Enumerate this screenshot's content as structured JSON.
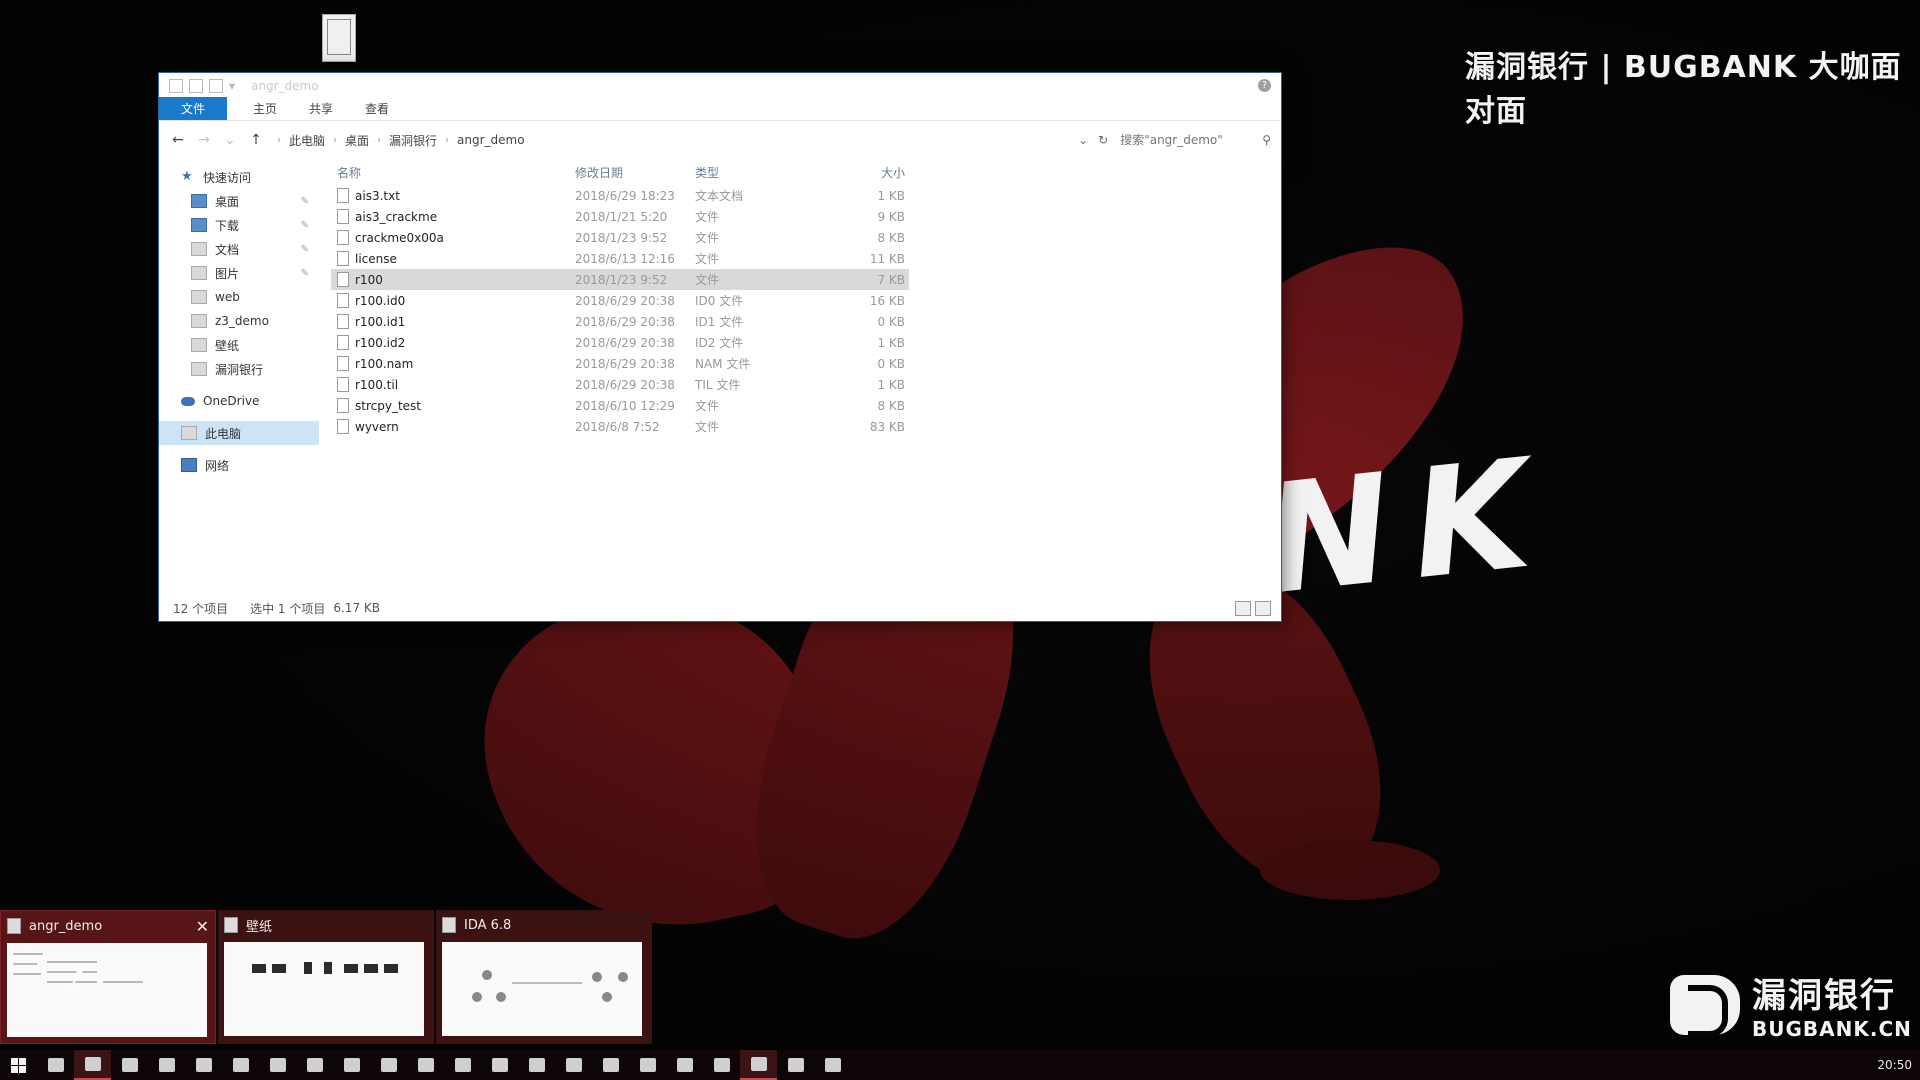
{
  "brand": {
    "top_text": "漏洞银行 | BUGBANK 大咖面对面",
    "bottom_cn": "漏洞银行",
    "bottom_en": "BUGBANK.CN",
    "wallpaper_letters": "NK"
  },
  "colors": {
    "accent": "#1979ca",
    "wallpaper_red": "#7a1719",
    "taskbar": "#0e0506"
  },
  "explorer": {
    "title": "angr_demo",
    "help_icon": "?",
    "ribbon_tabs": [
      "文件",
      "主页",
      "共享",
      "查看"
    ],
    "breadcrumb": [
      "此电脑",
      "桌面",
      "漏洞银行",
      "angr_demo"
    ],
    "search_placeholder": "搜索\"angr_demo\"",
    "nav": [
      {
        "label": "快速访问",
        "icon": "star-icon"
      },
      {
        "label": "桌面",
        "icon": "desktop-icon",
        "pinned": true
      },
      {
        "label": "下载",
        "icon": "download-icon",
        "pinned": true
      },
      {
        "label": "文档",
        "icon": "document-icon",
        "pinned": true
      },
      {
        "label": "图片",
        "icon": "picture-icon",
        "pinned": true
      },
      {
        "label": "web",
        "icon": "folder-icon"
      },
      {
        "label": "z3_demo",
        "icon": "folder-icon"
      },
      {
        "label": "壁纸",
        "icon": "folder-icon"
      },
      {
        "label": "漏洞银行",
        "icon": "folder-icon"
      },
      {
        "label": "OneDrive",
        "icon": "cloud-icon"
      },
      {
        "label": "此电脑",
        "icon": "computer-icon",
        "selected": true
      },
      {
        "label": "网络",
        "icon": "network-icon"
      }
    ],
    "columns": {
      "name": "名称",
      "date": "修改日期",
      "type": "类型",
      "size": "大小"
    },
    "files": [
      {
        "name": "ais3.txt",
        "date": "2018/6/29 18:23",
        "type": "文本文档",
        "size": "1 KB"
      },
      {
        "name": "ais3_crackme",
        "date": "2018/1/21 5:20",
        "type": "文件",
        "size": "9 KB"
      },
      {
        "name": "crackme0x00a",
        "date": "2018/1/23 9:52",
        "type": "文件",
        "size": "8 KB"
      },
      {
        "name": "license",
        "date": "2018/6/13 12:16",
        "type": "文件",
        "size": "11 KB"
      },
      {
        "name": "r100",
        "date": "2018/1/23 9:52",
        "type": "文件",
        "size": "7 KB",
        "selected": true
      },
      {
        "name": "r100.id0",
        "date": "2018/6/29 20:38",
        "type": "ID0 文件",
        "size": "16 KB"
      },
      {
        "name": "r100.id1",
        "date": "2018/6/29 20:38",
        "type": "ID1 文件",
        "size": "0 KB"
      },
      {
        "name": "r100.id2",
        "date": "2018/6/29 20:38",
        "type": "ID2 文件",
        "size": "1 KB"
      },
      {
        "name": "r100.nam",
        "date": "2018/6/29 20:38",
        "type": "NAM 文件",
        "size": "0 KB"
      },
      {
        "name": "r100.til",
        "date": "2018/6/29 20:38",
        "type": "TIL 文件",
        "size": "1 KB"
      },
      {
        "name": "strcpy_test",
        "date": "2018/6/10 12:29",
        "type": "文件",
        "size": "8 KB"
      },
      {
        "name": "wyvern",
        "date": "2018/6/8 7:52",
        "type": "文件",
        "size": "83 KB"
      }
    ],
    "status": {
      "count": "12 个项目",
      "selected": "选中 1 个项目",
      "size": "6.17 KB"
    }
  },
  "thumbnails": [
    {
      "title": "angr_demo",
      "closable": true
    },
    {
      "title": "壁纸",
      "closable": false
    },
    {
      "title": "IDA 6.8",
      "closable": false
    }
  ],
  "taskbar": {
    "items": [
      "start",
      "ie",
      "file-explorer",
      "store",
      "mail",
      "chrome",
      "chrome-alt",
      "onenote",
      "illustrator",
      "settings",
      "browser",
      "unity",
      "photoshop",
      "notepad",
      "docs",
      "pycharm",
      "wechat",
      "app",
      "arrow-tool",
      "chrome-2",
      "ida",
      "terminal",
      "burp"
    ],
    "clock": "20:50"
  }
}
